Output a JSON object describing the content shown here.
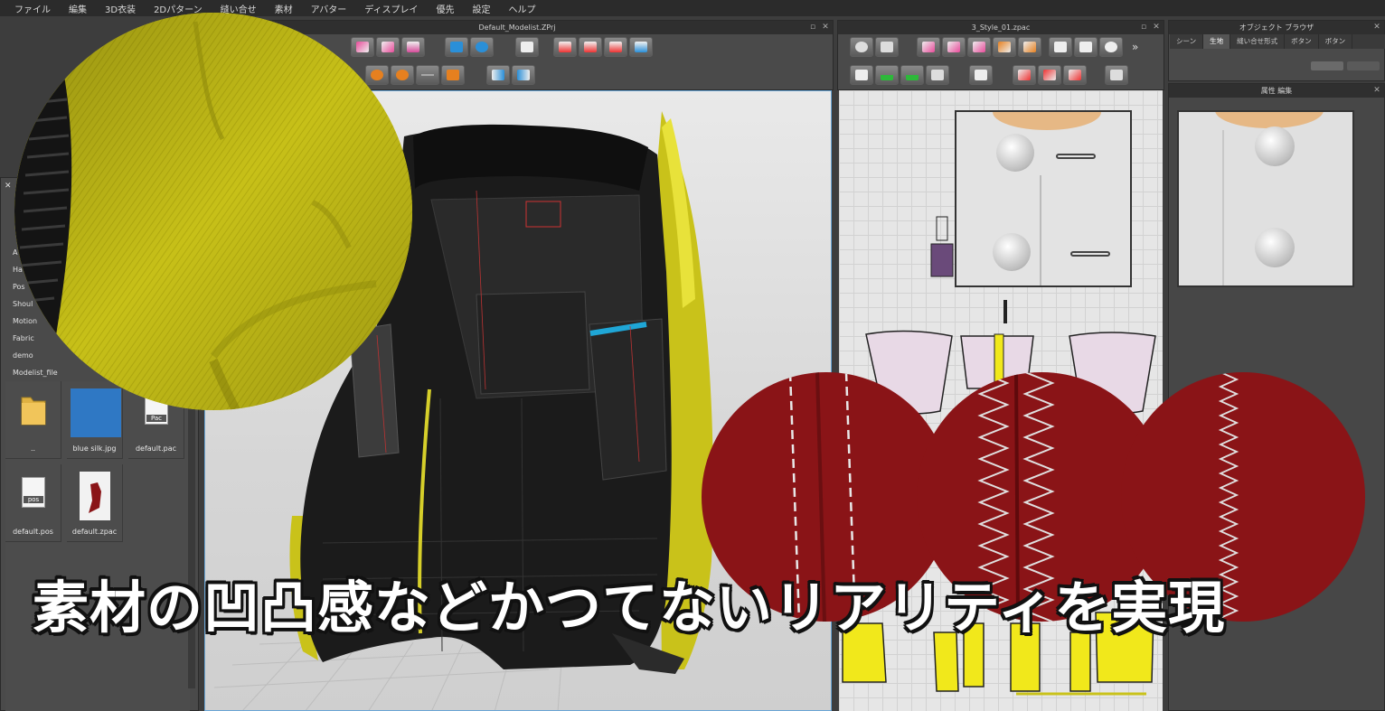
{
  "menu": [
    "ファイル",
    "編集",
    "3D衣装",
    "2Dパターン",
    "縫い合せ",
    "素材",
    "アバター",
    "ディスプレイ",
    "優先",
    "設定",
    "ヘルプ"
  ],
  "viewport3d": {
    "title": "Default_Modelist.ZPrj"
  },
  "pattern2d": {
    "title": "3_Style_01.zpac"
  },
  "object_browser": {
    "title": "オブジェクト ブラウザ",
    "tabs": [
      "シーン",
      "生地",
      "縫い合せ形式",
      "ボタン",
      "ボタン"
    ],
    "active_tab": 1
  },
  "properties": {
    "title": "属性 編集"
  },
  "library": {
    "folders": [
      "A",
      "Ha",
      "Pos",
      "Shoul",
      "Motion",
      "Fabric",
      "demo",
      "Modelist_file"
    ],
    "files": [
      {
        "name": "..",
        "icon": "folder-icon"
      },
      {
        "name": "blue silk.jpg",
        "icon": "fabric-swatch"
      },
      {
        "name": "default.pac",
        "icon": "pac-file-icon",
        "tag": "Pac"
      },
      {
        "name": "default.pos",
        "icon": "pos-file-icon",
        "tag": "pos"
      },
      {
        "name": "default.zpac",
        "icon": "garment-thumb"
      }
    ]
  },
  "caption": "素材の凹凸感などかつてないリアリティを実現",
  "colors": {
    "jacket": "#1a1a1a",
    "lining": "#c9c21a",
    "stitch_red": "#8a1417",
    "accent_cyan": "#1fa6d6",
    "pattern_yellow": "#f1e81b"
  }
}
